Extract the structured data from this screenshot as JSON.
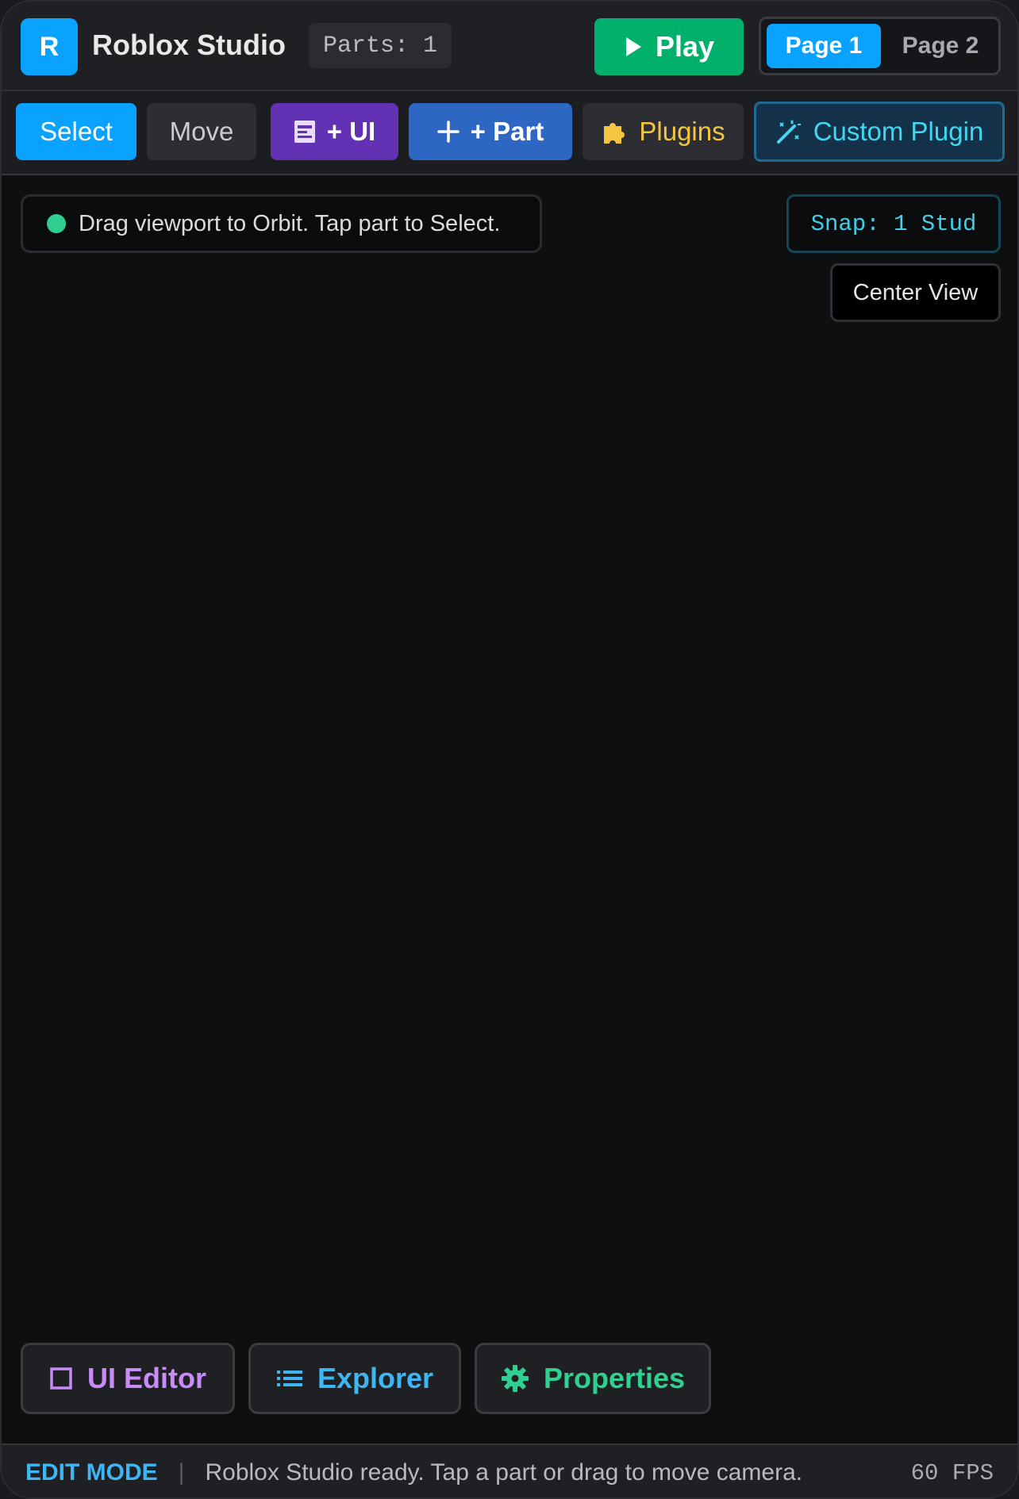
{
  "header": {
    "logo_letter": "R",
    "app_title": "Roblox Studio",
    "parts_count": "Parts: 1",
    "play_label": "Play",
    "pages": [
      {
        "label": "Page 1",
        "active": true
      },
      {
        "label": "Page 2",
        "active": false
      }
    ]
  },
  "toolbar": {
    "select_label": "Select",
    "move_label": "Move",
    "add_ui_label": "+ UI",
    "add_part_label": "+ Part",
    "plugins_label": "Plugins",
    "custom_plugin_label": "Custom Plugin",
    "icons": [
      "panel-icon",
      "plus-icon",
      "puzzle-icon",
      "magic-wand-icon"
    ]
  },
  "viewport": {
    "hint_text": "Drag viewport to Orbit. Tap part to Select.",
    "snap_label": "Snap: 1 Stud",
    "center_view_label": "Center View"
  },
  "panels": {
    "ui_editor_label": "UI Editor",
    "explorer_label": "Explorer",
    "properties_label": "Properties"
  },
  "statusbar": {
    "mode": "EDIT MODE",
    "separator": "|",
    "message": "Roblox Studio ready. Tap a part or drag to move camera.",
    "fps": "60 FPS"
  },
  "colors": {
    "accent_blue": "#0aa2ff",
    "play_green": "#00b06b",
    "ui_purple": "#6231b4",
    "part_blue": "#2e66c3",
    "plugins_yellow": "#f5c542",
    "custom_cyan": "#3fd8f0",
    "status_green": "#2ecf8e"
  }
}
